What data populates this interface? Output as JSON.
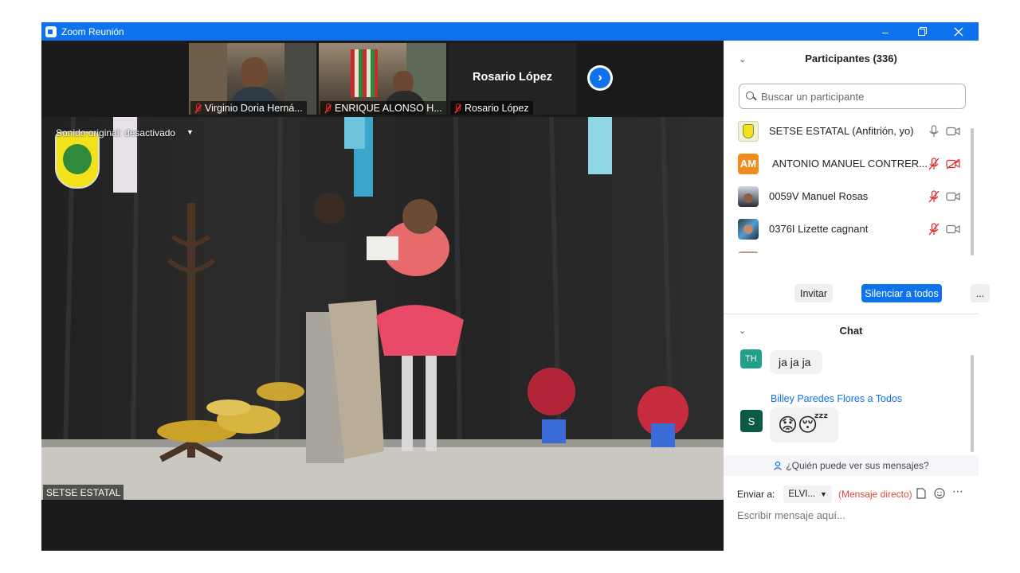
{
  "window": {
    "title": "Zoom Reunión"
  },
  "thumbnails": [
    {
      "name": "Virginio Doria Herná...",
      "muted": true
    },
    {
      "name": "ENRIQUE ALONSO H...",
      "muted": true
    },
    {
      "name": "Rosario López",
      "display_name": "Rosario López",
      "muted": true
    }
  ],
  "main_video": {
    "sound_label": "Sonido original: desactivado",
    "speaker": "SETSE ESTATAL"
  },
  "participants": {
    "title": "Participantes (336)",
    "search_placeholder": "Buscar un participante",
    "list": [
      {
        "name": "SETSE ESTATAL (Anfitrión, yo)",
        "mic": "on",
        "cam": "on"
      },
      {
        "name": "ANTONIO MANUEL CONTRER...",
        "initials": "AM",
        "mic": "muted",
        "cam": "off"
      },
      {
        "name": "0059V Manuel Rosas",
        "mic": "muted",
        "cam": "on"
      },
      {
        "name": "0376I Lizette cagnant",
        "mic": "muted",
        "cam": "on"
      }
    ],
    "buttons": {
      "invite": "Invitar",
      "mute_all": "Silenciar a todos",
      "more": "..."
    }
  },
  "chat": {
    "title": "Chat",
    "messages": [
      {
        "initials": "TH",
        "text": "ja ja ja"
      },
      {
        "initials": "S",
        "sender": "Billey Paredes Flores a Todos",
        "text": "😟😴"
      }
    ],
    "who_can_see": "¿Quién puede ver sus mensajes?",
    "send_to_label": "Enviar a:",
    "send_to_value": "ELVI...",
    "direct_label": "(Mensaje directo)",
    "input_placeholder": "Escribir mensaje aquí..."
  },
  "colors": {
    "accent": "#0e72ed",
    "muted_red": "#e02828"
  }
}
